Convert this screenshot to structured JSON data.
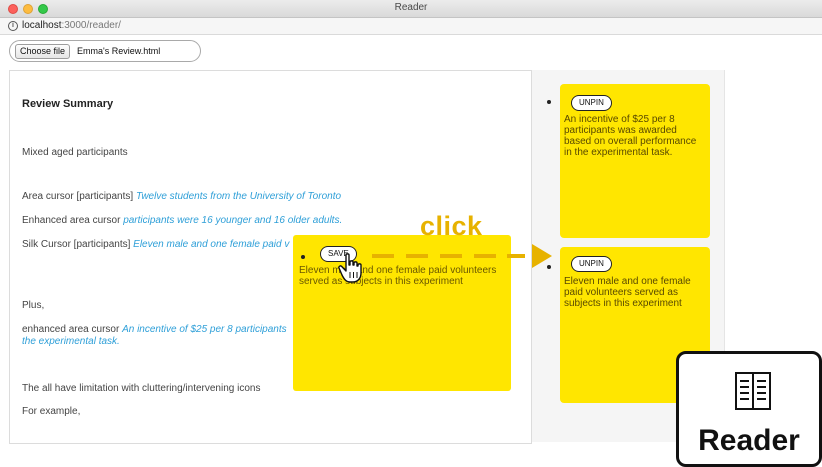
{
  "window": {
    "title": "Reader",
    "url_host": "localhost",
    "url_path": ":3000/reader/"
  },
  "file_input": {
    "button_label": "Choose file",
    "file_name": "Emma's Review.html"
  },
  "document": {
    "heading": "Review Summary",
    "line1": "Mixed aged participants",
    "line2_prefix": "Area cursor [participants]",
    "line2_cite": "Twelve students from the University of Toronto",
    "line3_prefix": "Enhanced area cursor",
    "line3_cite": "participants were 16 younger and 16 older adults.",
    "line4_prefix": "Silk Cursor [participants]",
    "line4_cite": "Eleven male and one female paid v",
    "line5": "Plus,",
    "line6_prefix": "enhanced area cursor",
    "line6_cite_a": "An incentive of $25 per 8 participants",
    "line6_cite_b": "the experimental task.",
    "line7": "The all have limitation with cluttering/intervening icons",
    "line8": "For example,"
  },
  "popup": {
    "save_label": "SAVE",
    "text": "Eleven male and one female paid volunteers served as subjects in this experiment"
  },
  "annotation": {
    "click_label": "click"
  },
  "pinned": [
    {
      "unpin_label": "UNPIN",
      "text": "An incentive of $25 per 8 participants was awarded based on overall performance in the experimental task."
    },
    {
      "unpin_label": "UNPIN",
      "text": "Eleven male and one female paid volunteers served as subjects in this experiment"
    }
  ],
  "logo": {
    "text": "Reader",
    "icon": "open-book-icon"
  },
  "colors": {
    "highlight_yellow": "#ffe600",
    "annotation_gold": "#e7b200",
    "citation_blue": "#2e9fd8"
  }
}
